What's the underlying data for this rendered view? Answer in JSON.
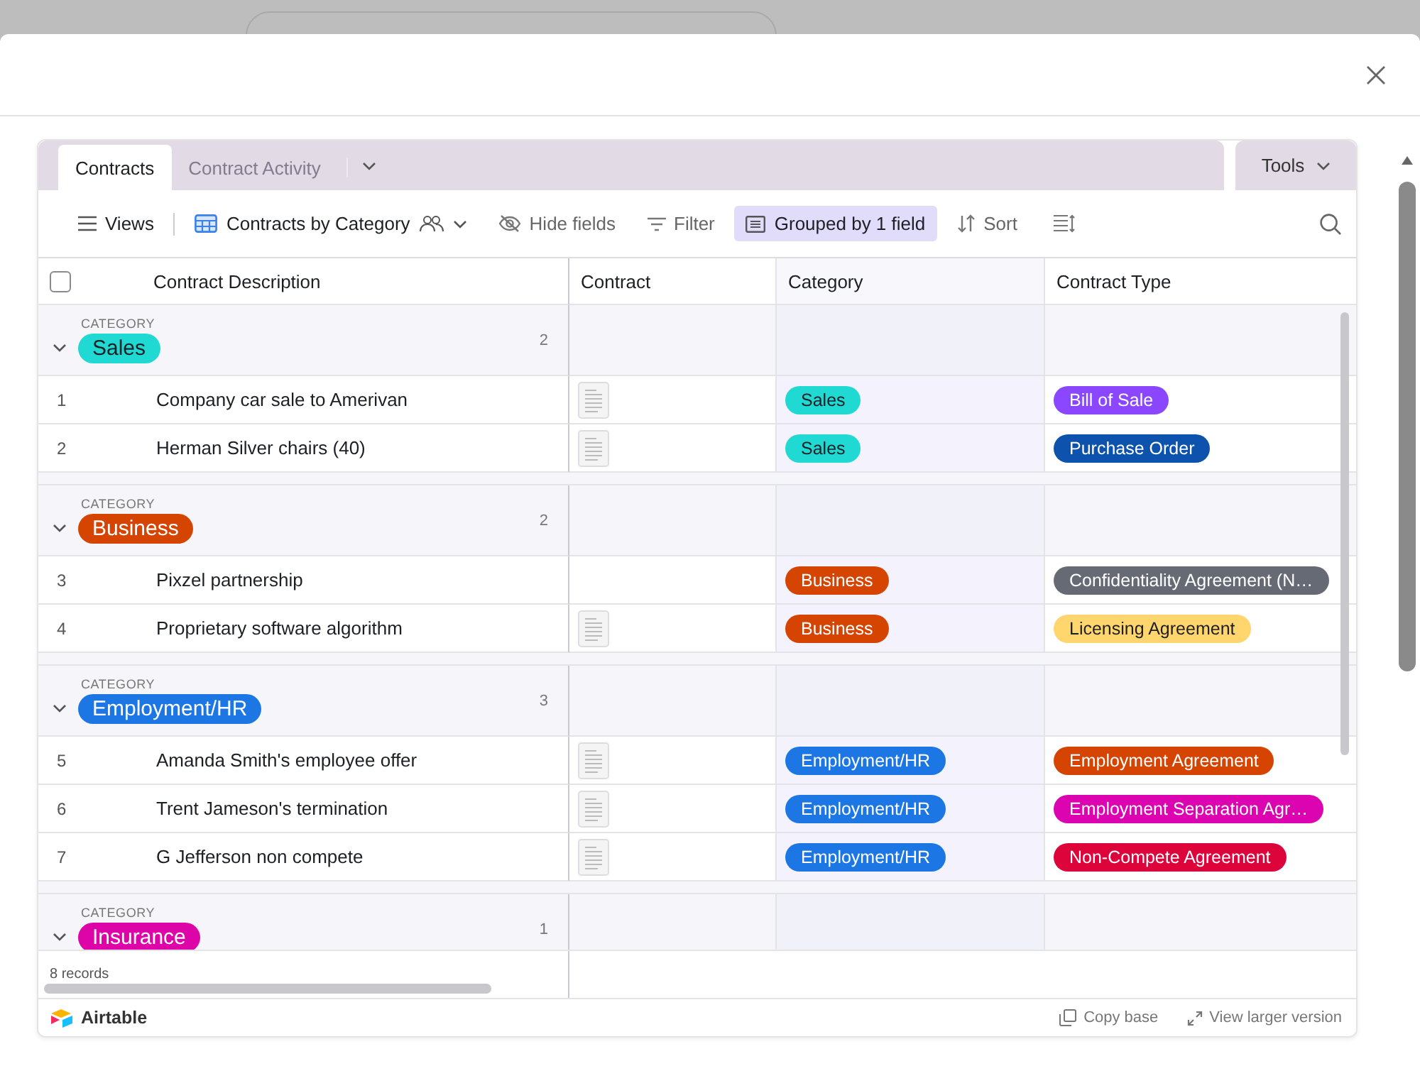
{
  "tabs": [
    {
      "label": "Contracts",
      "selected": true
    },
    {
      "label": "Contract Activity",
      "selected": false
    }
  ],
  "tools": "Tools",
  "toolbar": {
    "views": "Views",
    "view_name": "Contracts by Category",
    "hide_fields": "Hide fields",
    "filter": "Filter",
    "group": "Grouped by 1 field",
    "sort": "Sort"
  },
  "columns": [
    "Contract Description",
    "Contract",
    "Category",
    "Contract Type"
  ],
  "groups": [
    {
      "label": "CATEGORY",
      "name": "Sales",
      "color": "#20d9d2",
      "count": "2",
      "expanded": true,
      "rows": [
        {
          "number": "1",
          "description": "Company car sale to Amerivan",
          "attachment": true,
          "category": {
            "label": "Sales",
            "color": "#20d9d2"
          },
          "type": {
            "label": "Bill of Sale",
            "color": "#8b46ff"
          }
        },
        {
          "number": "2",
          "description": "Herman Silver chairs (40)",
          "attachment": true,
          "category": {
            "label": "Sales",
            "color": "#20d9d2"
          },
          "type": {
            "label": "Purchase Order",
            "color": "#0d52ac"
          }
        }
      ]
    },
    {
      "label": "CATEGORY",
      "name": "Business",
      "color": "#d54401",
      "count": "2",
      "expanded": true,
      "rows": [
        {
          "number": "3",
          "description": "Pixzel partnership",
          "attachment": false,
          "category": {
            "label": "Business",
            "color": "#d54401"
          },
          "type": {
            "label": "Confidentiality Agreement (N…",
            "color": "#666a74"
          }
        },
        {
          "number": "4",
          "description": "Proprietary software algorithm",
          "attachment": true,
          "category": {
            "label": "Business",
            "color": "#d54401"
          },
          "type": {
            "label": "Licensing Agreement",
            "color": "#ffd66e"
          }
        }
      ]
    },
    {
      "label": "CATEGORY",
      "name": "Employment/HR",
      "color": "#1c77e4",
      "count": "3",
      "expanded": true,
      "rows": [
        {
          "number": "5",
          "description": "Amanda Smith's employee offer",
          "attachment": true,
          "category": {
            "label": "Employment/HR",
            "color": "#1c77e4"
          },
          "type": {
            "label": "Employment Agreement",
            "color": "#d54401"
          }
        },
        {
          "number": "6",
          "description": "Trent Jameson's termination",
          "attachment": true,
          "category": {
            "label": "Employment/HR",
            "color": "#1c77e4"
          },
          "type": {
            "label": "Employment Separation Agr…",
            "color": "#dc04b0"
          }
        },
        {
          "number": "7",
          "description": "G Jefferson non compete",
          "attachment": true,
          "category": {
            "label": "Employment/HR",
            "color": "#1c77e4"
          },
          "type": {
            "label": "Non-Compete Agreement",
            "color": "#dc043b"
          }
        }
      ]
    },
    {
      "label": "CATEGORY",
      "name": "Insurance",
      "color": "#dd04a8",
      "count": "1",
      "expanded": true
    }
  ],
  "select_all": {
    "checked": false
  },
  "records": "8 records",
  "footer": {
    "brand": "Airtable",
    "copy": "Copy base",
    "view_larger": "View larger version"
  }
}
